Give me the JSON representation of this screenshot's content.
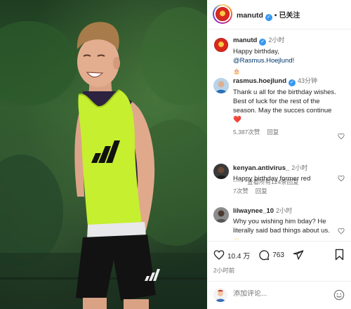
{
  "post": {
    "photo_alt": "player laughing in yellow training bib",
    "account": "manutd",
    "follow_state": "已关注",
    "caption": {
      "username": "manutd",
      "time": "2小时",
      "text_prefix": "Happy birthday, ",
      "mention": "@Rasmus.Hoejlund",
      "text_suffix": "!",
      "extra_emoji": "🎂"
    }
  },
  "comments": [
    {
      "username": "rasmus.hoejlund",
      "verified": true,
      "time": "43分钟",
      "text": "Thank u all for the birthday wishes. Best of luck for the rest of the season. May the succes continue❤️",
      "likes": "5,387次赞",
      "reply": "回复",
      "view_replies": "查看所有124条回复"
    },
    {
      "username": "kenyan.antivirus_",
      "verified": false,
      "time": "2小时",
      "text": "Happy birthday former red",
      "likes": "7次赞",
      "reply": "回复"
    },
    {
      "username": "lilwaynee_10",
      "verified": false,
      "time": "2小时",
      "text": "Why you wishing him bday? He literally said bad things about us.",
      "extra_emoji": "😬"
    }
  ],
  "actions": {
    "likes_count": "10.4 万",
    "comments_count": "763",
    "posted": "2小时前"
  },
  "add_comment": {
    "placeholder": "添加评论..."
  },
  "icons": {
    "like": "heart-icon",
    "comment": "comment-bubble-icon",
    "share": "send-icon",
    "save": "bookmark-icon",
    "emoji": "smiley-icon"
  },
  "colors": {
    "verified": "#3897f0",
    "mention": "#00376b",
    "bib": "#c6ef2f",
    "club_red": "#da291c"
  }
}
